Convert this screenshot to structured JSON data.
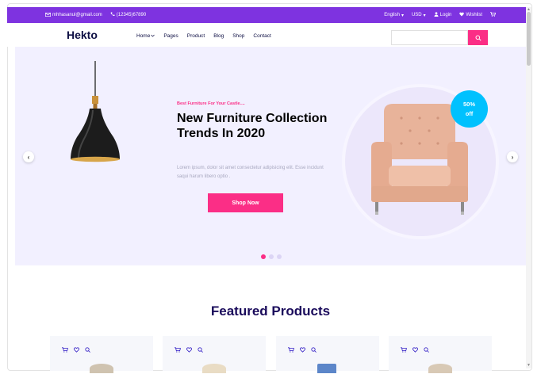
{
  "topbar": {
    "email": "mhhasanul@gmail.com",
    "phone": "(12345)67890",
    "language": "English",
    "currency": "USD",
    "login": "Login",
    "wishlist": "Wishlist"
  },
  "navbar": {
    "logo": "Hekto",
    "menu": [
      "Home",
      "Pages",
      "Product",
      "Blog",
      "Shop",
      "Contact"
    ],
    "search_placeholder": ""
  },
  "hero": {
    "tagline": "Best Furniture For Your Castle....",
    "headline": "New Furniture Collection Trends In 2020",
    "description": "Lorem ipsum, dolor sit amet consectetur adipisicing elit. Esse incidunt saqui harum libero optio .",
    "button": "Shop Now",
    "badge_line1": "50%",
    "badge_line2": "off",
    "active_slide": 0,
    "slide_count": 3
  },
  "featured": {
    "title": "Featured Products",
    "card_count": 4
  },
  "colors": {
    "purple": "#7e33e0",
    "pink": "#fb2e86",
    "navy": "#0d0e43",
    "cyan": "#00c1fe",
    "hero_bg": "#f2f0ff"
  }
}
